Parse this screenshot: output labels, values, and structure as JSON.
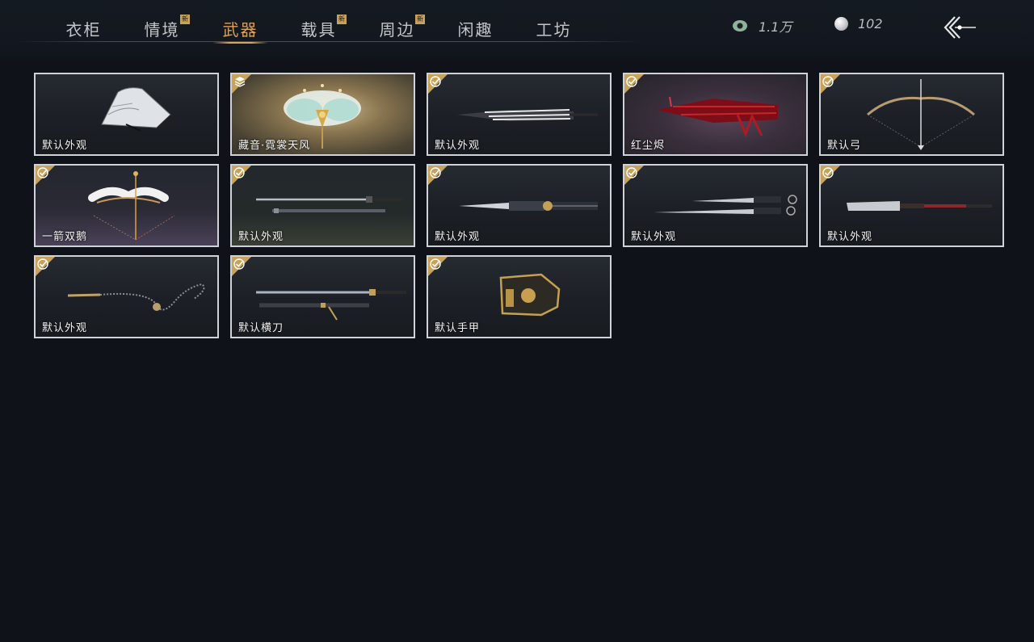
{
  "tabs": [
    {
      "label": "衣柜",
      "active": false,
      "new": false
    },
    {
      "label": "情境",
      "active": false,
      "new": true
    },
    {
      "label": "武器",
      "active": true,
      "new": false
    },
    {
      "label": "载具",
      "active": false,
      "new": true
    },
    {
      "label": "周边",
      "active": false,
      "new": true
    },
    {
      "label": "闲趣",
      "active": false,
      "new": false
    },
    {
      "label": "工坊",
      "active": false,
      "new": false
    }
  ],
  "new_badge": "新",
  "currency": {
    "coin": {
      "icon": "copper-coin-icon",
      "value": "1.1万"
    },
    "pearl": {
      "icon": "pearl-icon",
      "value": "102"
    }
  },
  "colors": {
    "accent": "#d9a35b",
    "badge": "#c8a25a",
    "background": "#0f1319",
    "card_border": "#cfd2d6"
  },
  "items": [
    {
      "label": "默认外观",
      "icon": "folding-fan-icon",
      "status": "equipped"
    },
    {
      "label": "藏音·霓裳天风",
      "icon": "ornate-fan-icon",
      "status": "stacked"
    },
    {
      "label": "默认外观",
      "icon": "umbrella-icon",
      "status": "owned"
    },
    {
      "label": "红尘烬",
      "icon": "red-umbrella-icon",
      "status": "owned"
    },
    {
      "label": "默认弓",
      "icon": "bow-icon",
      "status": "owned"
    },
    {
      "label": "一箭双鹅",
      "icon": "goose-bow-icon",
      "status": "owned"
    },
    {
      "label": "默认外观",
      "icon": "sword-and-scabbard-icon",
      "status": "owned"
    },
    {
      "label": "默认外观",
      "icon": "dual-blade-icon",
      "status": "owned"
    },
    {
      "label": "默认外观",
      "icon": "twin-sabers-icon",
      "status": "owned"
    },
    {
      "label": "默认外观",
      "icon": "long-glaive-icon",
      "status": "owned"
    },
    {
      "label": "默认外观",
      "icon": "rope-dart-icon",
      "status": "owned"
    },
    {
      "label": "默认横刀",
      "icon": "hengdao-icon",
      "status": "owned"
    },
    {
      "label": "默认手甲",
      "icon": "gauntlet-icon",
      "status": "owned"
    }
  ]
}
